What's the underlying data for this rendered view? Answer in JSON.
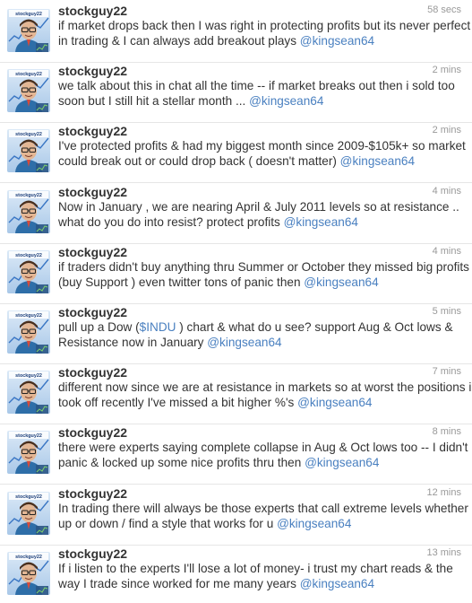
{
  "tweets": [
    {
      "user": "stockguy22",
      "time": "58 secs",
      "lines": [
        {
          "text": "if market drops back then I was right in protecting profits but its never perfect"
        },
        {
          "text": "in trading & I can always add breakout plays ",
          "mention": "@kingsean64"
        }
      ]
    },
    {
      "user": "stockguy22",
      "time": "2 mins",
      "lines": [
        {
          "text": "we talk about this in chat all the time -- if market breaks out then i sold too"
        },
        {
          "text": "soon but I still hit a stellar month ...  ",
          "mention": "@kingsean64"
        }
      ]
    },
    {
      "user": "stockguy22",
      "time": "2 mins",
      "lines": [
        {
          "text": "I've protected profits & had my biggest month since 2009-$105k+ so market"
        },
        {
          "text": "could break out or could drop back ( doesn't matter) ",
          "mention": "@kingsean64"
        }
      ]
    },
    {
      "user": "stockguy22",
      "time": "4 mins",
      "lines": [
        {
          "text": "Now in January , we are nearing April & July 2011 levels so at resistance .."
        },
        {
          "text": "what do you do into resist? protect profits ",
          "mention": "@kingsean64"
        }
      ]
    },
    {
      "user": "stockguy22",
      "time": "4 mins",
      "lines": [
        {
          "text": "if traders didn't buy anything thru Summer or October they missed big profits"
        },
        {
          "text": "(buy Support ) even twitter tons of panic then  ",
          "mention": "@kingsean64"
        }
      ]
    },
    {
      "user": "stockguy22",
      "time": "5 mins",
      "lines": [
        {
          "text": "pull up a Dow (",
          "link": "$INDU",
          "after": " ) chart & what do u see? support Aug & Oct lows &"
        },
        {
          "text": "Resistance now in January ",
          "mention": "@kingsean64"
        }
      ]
    },
    {
      "user": "stockguy22",
      "time": "7 mins",
      "lines": [
        {
          "text": "different now since we are at resistance in markets so at worst the positions i"
        },
        {
          "text": "took off recently I've missed a bit higher %'s ",
          "mention": "@kingsean64"
        }
      ]
    },
    {
      "user": "stockguy22",
      "time": "8 mins",
      "lines": [
        {
          "text": "there were experts saying complete collapse in Aug & Oct lows too -- I didn't"
        },
        {
          "text": "panic & locked up some nice profits thru then ",
          "mention": "@kingsean64"
        }
      ]
    },
    {
      "user": "stockguy22",
      "time": "12 mins",
      "lines": [
        {
          "text": "In trading there will always be those experts that call extreme levels whether"
        },
        {
          "text": "up or down /  find a style that works for u ",
          "mention": "@kingsean64"
        }
      ]
    },
    {
      "user": "stockguy22",
      "time": "13 mins",
      "lines": [
        {
          "text": "If i listen to the experts I'll lose a lot of money- i trust my chart reads & the"
        },
        {
          "text": "way I trade since worked for me many years ",
          "mention": "@kingsean64"
        }
      ]
    }
  ],
  "colors": {
    "text": "#333333",
    "link": "#4a80c0",
    "meta": "#999999",
    "divider": "#e6e6e6"
  },
  "avatar": {
    "label": "stockguy22"
  }
}
